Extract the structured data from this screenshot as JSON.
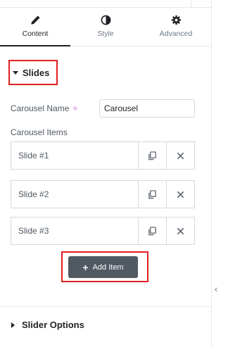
{
  "tabs": [
    {
      "label": "Content",
      "icon": "pencil-icon",
      "active": true
    },
    {
      "label": "Style",
      "icon": "half-circle-icon",
      "active": false
    },
    {
      "label": "Advanced",
      "icon": "gear-icon",
      "active": false
    }
  ],
  "slides_section": {
    "title": "Slides"
  },
  "carousel_name": {
    "label": "Carousel Name",
    "value": "Carousel"
  },
  "carousel_items": {
    "label": "Carousel Items",
    "items": [
      {
        "title": "Slide #1"
      },
      {
        "title": "Slide #2"
      },
      {
        "title": "Slide #3"
      }
    ]
  },
  "add_item": {
    "label": "Add Item"
  },
  "slider_options": {
    "title": "Slider Options"
  },
  "colors": {
    "highlight": "#e0201f",
    "button_bg": "#515962",
    "ai_accent": "#c44dd7"
  }
}
